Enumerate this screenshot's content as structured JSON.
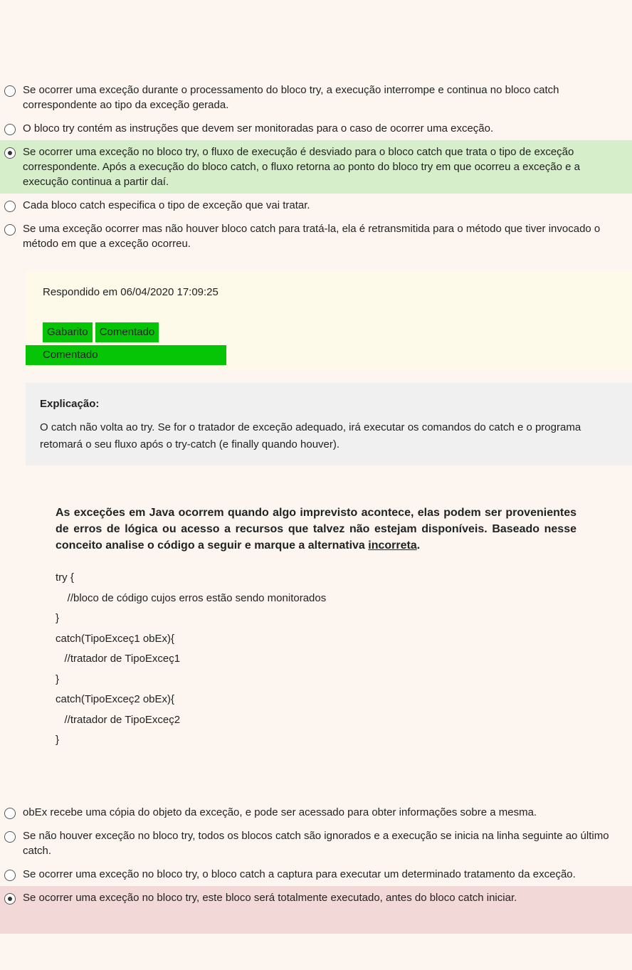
{
  "q1": {
    "options": [
      "Se ocorrer uma exceção durante o processamento do bloco try, a execução interrompe e continua no bloco catch correspondente ao tipo da exceção gerada.",
      "O bloco try contém as instruções que devem ser monitoradas para o caso de ocorrer uma exceção.",
      "Se ocorrer uma exceção no bloco try, o fluxo de execução é desviado para o bloco catch que trata o tipo de exceção correspondente. Após a execução do bloco catch, o fluxo retorna ao ponto do bloco try em que ocorreu a exceção e a execução continua a partir daí.",
      "Cada bloco catch especifica o tipo de exceção que vai tratar.",
      "Se uma exceção ocorrer mas não houver bloco catch para tratá-la, ela é retransmitida para o método que tiver invocado o método em que a exceção ocorreu."
    ],
    "selected_index": 2,
    "info": {
      "line1_before": "Respondido em ",
      "date1": "06/04/2020 17:09:25",
      "line2_after_br": "",
      "bar1_start": "Gabarito",
      "bar1_tail": "Comentado",
      "line3_before": "",
      "bar2": "Comentado"
    },
    "explanation_heading": "Explicação:",
    "explanation": "O catch não volta ao try. Se for o tratador de exceção adequado, irá executar os comandos do catch e o programa retomará o seu fluxo após o try-catch (e finally quando houver)."
  },
  "q2": {
    "prompt_bold_1": "As exceções em Java ocorrem quando algo imprevisto acontece, elas podem ser provenientes de erros de lógica ou acesso a recursos que talvez não estejam disponíveis. Baseado nesse conceito analise o código a seguir e marque a alternativa ",
    "prompt_u": "incorreta",
    "prompt_bold_3": ".",
    "code": "try {\n    //bloco de código cujos erros estão sendo monitorados\n}\ncatch(TipoExceç1 obEx){\n   //tratador de TipoExceç1\n}\ncatch(TipoExceç2 obEx){\n   //tratador de TipoExceç2\n}",
    "options": [
      "obEx recebe uma cópia do objeto da exceção, e pode ser acessado para obter informações sobre a mesma.",
      "Se não houver exceção no bloco try, todos os blocos catch são ignorados e a execução se inicia na linha seguinte ao último catch.",
      "Se ocorrer uma exceção no bloco try, o bloco catch a captura para executar um determinado tratamento da exceção.",
      "Se ocorrer uma exceção no bloco try, este bloco será totalmente executado, antes do bloco catch iniciar."
    ],
    "selected_index": 3
  }
}
